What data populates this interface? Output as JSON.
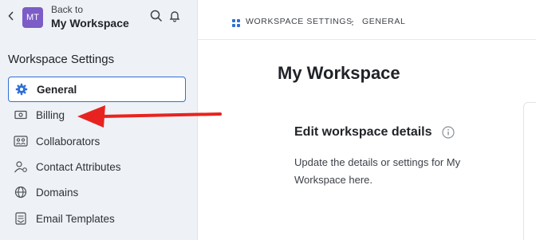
{
  "sidebar": {
    "back_label": "Back to",
    "avatar_initials": "MT",
    "workspace_name": "My Workspace",
    "title": "Workspace Settings",
    "items": [
      {
        "label": "General",
        "icon": "gear-icon",
        "active": true
      },
      {
        "label": "Billing",
        "icon": "billing-icon",
        "active": false
      },
      {
        "label": "Collaborators",
        "icon": "collaborators-icon",
        "active": false
      },
      {
        "label": "Contact Attributes",
        "icon": "contact-attributes-icon",
        "active": false
      },
      {
        "label": "Domains",
        "icon": "globe-icon",
        "active": false
      },
      {
        "label": "Email Templates",
        "icon": "email-templates-icon",
        "active": false
      }
    ]
  },
  "breadcrumb": {
    "parts": [
      "WORKSPACE SETTINGS",
      "GENERAL"
    ]
  },
  "main": {
    "page_title": "My Workspace",
    "section_title": "Edit workspace details",
    "section_description": "Update the details or settings for My Workspace here."
  },
  "colors": {
    "accent": "#2f6fd6",
    "avatar": "#7c5cc7",
    "sidebar_bg": "#eef2f6",
    "annotation_arrow": "#e8231f"
  }
}
